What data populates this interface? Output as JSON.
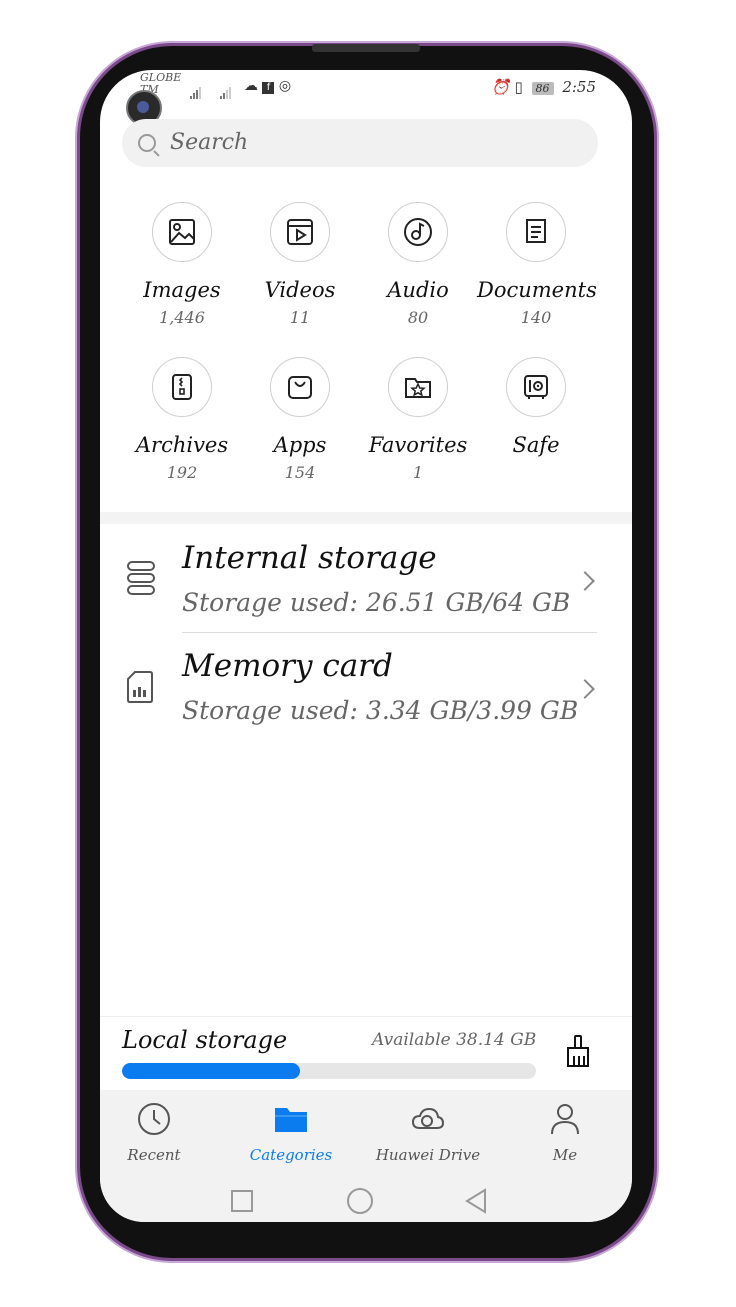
{
  "status_bar": {
    "carrier": "GLOBE",
    "carrier_sub": "TM",
    "time": "2:55",
    "battery": "86"
  },
  "search": {
    "placeholder": "Search"
  },
  "categories": [
    {
      "label": "Images",
      "count": "1,446",
      "icon": "image-icon"
    },
    {
      "label": "Videos",
      "count": "11",
      "icon": "video-icon"
    },
    {
      "label": "Audio",
      "count": "80",
      "icon": "music-icon"
    },
    {
      "label": "Documents",
      "count": "140",
      "icon": "document-icon"
    },
    {
      "label": "Archives",
      "count": "192",
      "icon": "archive-icon"
    },
    {
      "label": "Apps",
      "count": "154",
      "icon": "shopping-bag-icon"
    },
    {
      "label": "Favorites",
      "count": "1",
      "icon": "star-folder-icon"
    },
    {
      "label": "Safe",
      "count": "",
      "icon": "safe-icon"
    }
  ],
  "storage": [
    {
      "title": "Internal storage",
      "subtitle": "Storage used: 26.51 GB/64 GB"
    },
    {
      "title": "Memory card",
      "subtitle": "Storage used: 3.34 GB/3.99 GB"
    }
  ],
  "local_storage": {
    "label": "Local storage",
    "available": "Available 38.14 GB",
    "used_fraction": 0.43,
    "accent": "#0a7cf0"
  },
  "nav": [
    {
      "label": "Recent",
      "icon": "clock-icon",
      "active": false
    },
    {
      "label": "Categories",
      "icon": "folder-icon",
      "active": true
    },
    {
      "label": "Huawei Drive",
      "icon": "cloud-icon",
      "active": false
    },
    {
      "label": "Me",
      "icon": "person-icon",
      "active": false
    }
  ]
}
